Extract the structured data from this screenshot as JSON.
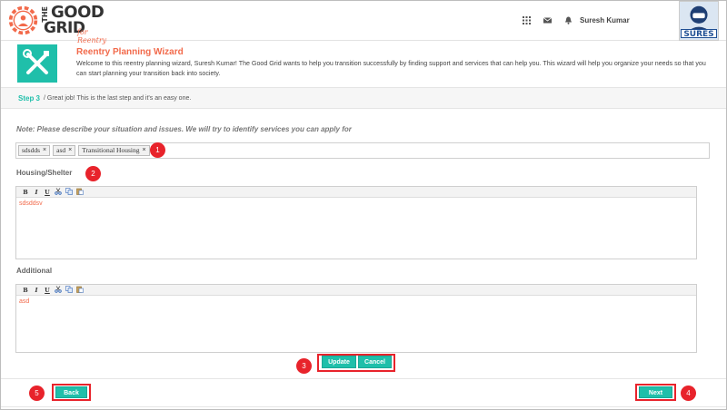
{
  "header": {
    "logo": {
      "the": "THE",
      "good": "GOOD",
      "grid": "GRID",
      "for": "for Reentry"
    },
    "icons": [
      "apps-grid-icon",
      "mail-icon",
      "bell-icon"
    ],
    "user_name": "Suresh Kumar",
    "avatar_label": "SURES"
  },
  "wizard": {
    "title": "Reentry Planning Wizard",
    "description": "Welcome to this reentry planning wizard, Suresh Kumar! The Good Grid wants to help you transition successfully by finding support and services that can help you. This wizard will help you organize your needs so that you can start planning your transition back into society."
  },
  "step": {
    "label": "Step 3",
    "text": "/ Great job! This is the last step and it's an easy one."
  },
  "note": "Note: Please describe your situation and issues. We will try to identify services you can apply for",
  "tags": [
    "sdsdds",
    "asd",
    "Transitional Housing"
  ],
  "tag_remove": "×",
  "sections": {
    "housing": {
      "label": "Housing/Shelter",
      "content": "sdsddsv"
    },
    "additional": {
      "label": "Additional",
      "content": "asd"
    }
  },
  "toolbar": {
    "bold": "B",
    "italic": "I",
    "underline": "U"
  },
  "buttons": {
    "update": "Update",
    "cancel": "Cancel",
    "back": "Back",
    "next": "Next"
  },
  "badges": [
    "1",
    "2",
    "3",
    "4",
    "5"
  ],
  "colors": {
    "accent": "#1fbfaa",
    "title_orange": "#f26a4b",
    "highlight_red": "#e8232b"
  }
}
